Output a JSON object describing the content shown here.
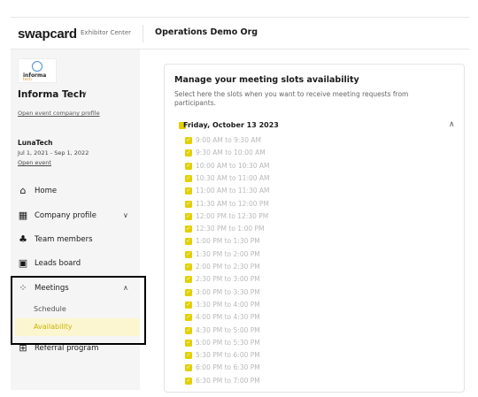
{
  "header": {
    "logo": "swapcard",
    "product": "Exhibitor Center",
    "org_title": "Operations Demo Org"
  },
  "sidebar": {
    "org_logo_text": "informa",
    "org_logo_subtext": "tech",
    "org_name": "Informa Tech",
    "open_company_profile": "Open event company profile",
    "event": {
      "title": "LunaTech",
      "dates": "Jul 1, 2021 - Sep 1, 2022",
      "open_event": "Open event"
    },
    "nav": [
      {
        "label": "Home",
        "icon": "home-icon"
      },
      {
        "label": "Company profile",
        "icon": "store-icon"
      },
      {
        "label": "Team members",
        "icon": "team-icon"
      },
      {
        "label": "Leads board",
        "icon": "leads-icon"
      },
      {
        "label": "Meetings",
        "icon": "meetings-icon"
      },
      {
        "label": "Referral program",
        "icon": "gift-icon"
      }
    ],
    "meetings_sub": [
      {
        "label": "Schedule"
      },
      {
        "label": "Availability"
      }
    ]
  },
  "main": {
    "title": "Manage your meeting slots availability",
    "subtitle": "Select here the slots when you want to receive meeting requests from participants.",
    "day": "Friday, October 13 2023",
    "slots": [
      "9:00 AM to 9:30 AM",
      "9:30 AM to 10:00 AM",
      "10:00 AM to 10:30 AM",
      "10:30 AM to 11:00 AM",
      "11:00 AM to 11:30 AM",
      "11:30 AM to 12:00 PM",
      "12:00 PM to 12:30 PM",
      "12:30 PM to 1:00 PM",
      "1:00 PM to 1:30 PM",
      "1:30 PM to 2:00 PM",
      "2:00 PM to 2:30 PM",
      "2:30 PM to 3:00 PM",
      "3:00 PM to 3:30 PM",
      "3:30 PM to 4:00 PM",
      "4:00 PM to 4:30 PM",
      "4:30 PM to 5:00 PM",
      "5:00 PM to 5:30 PM",
      "5:30 PM to 6:00 PM",
      "6:00 PM to 6:30 PM",
      "6:30 PM to 7:00 PM"
    ]
  },
  "colors": {
    "accent": "#e2d000",
    "active_bg": "#fbf6cf",
    "sidebar_bg": "#f5f5f5"
  }
}
